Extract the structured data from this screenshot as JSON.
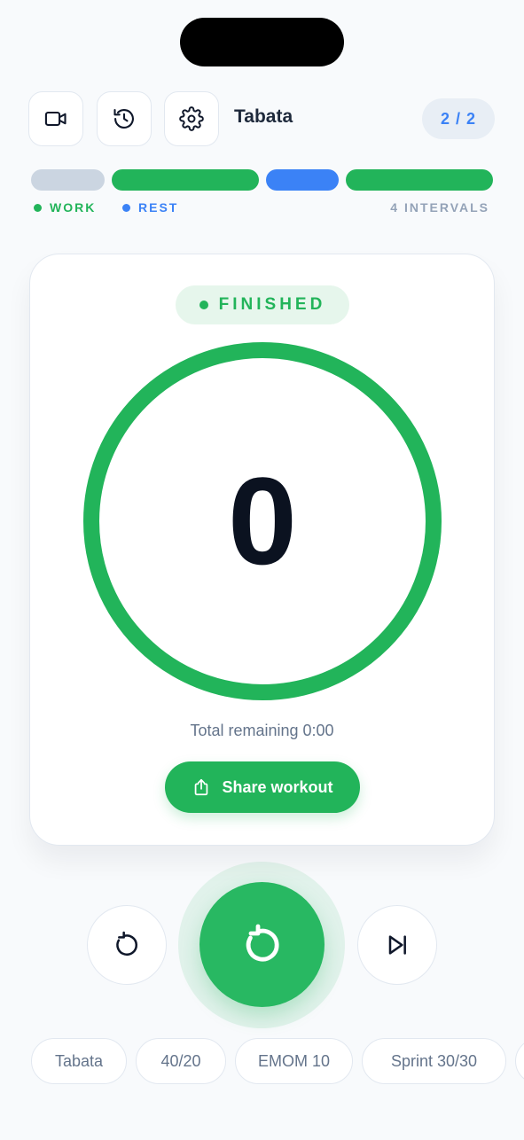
{
  "header": {
    "title": "Tabata",
    "counter": "2 / 2",
    "icons": [
      "video-camera-icon",
      "history-icon",
      "gear-icon"
    ]
  },
  "intervals": {
    "segments": [
      {
        "kind": "done",
        "color": "#cbd5e1"
      },
      {
        "kind": "work",
        "color": "#22b45a"
      },
      {
        "kind": "rest",
        "color": "#3b82f6"
      },
      {
        "kind": "work",
        "color": "#22b45a"
      }
    ],
    "legend_work": "WORK",
    "legend_rest": "REST",
    "count_label": "4 INTERVALS"
  },
  "timer": {
    "status": "FINISHED",
    "value": "0",
    "remaining": "Total remaining 0:00",
    "share_label": "Share workout",
    "ring_progress": 1.0
  },
  "controls": {
    "icons": [
      "restart-icon",
      "reset-icon",
      "skip-end-icon"
    ]
  },
  "presets": [
    "Tabata",
    "40/20",
    "EMOM 10",
    "Sprint 30/30"
  ],
  "colors": {
    "work": "#22b45a",
    "rest": "#3b82f6",
    "done": "#cbd5e1",
    "background": "#f8fafc"
  }
}
